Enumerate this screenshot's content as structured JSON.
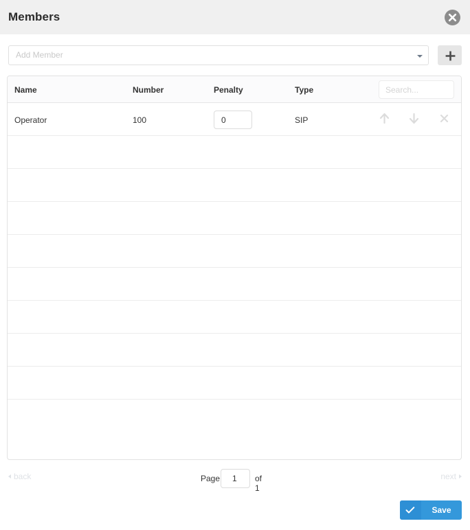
{
  "header": {
    "title": "Members",
    "close_icon": "close-circle-icon"
  },
  "add_member": {
    "placeholder": "Add Member",
    "caret_icon": "chevron-down-icon",
    "add_icon": "plus-icon"
  },
  "table": {
    "columns": [
      "Name",
      "Number",
      "Penalty",
      "Type"
    ],
    "search": {
      "placeholder": "Search..."
    },
    "row_actions": {
      "up_icon": "arrow-up-icon",
      "down_icon": "arrow-down-icon",
      "delete_icon": "close-x-icon"
    },
    "rows": [
      {
        "name": "Operator",
        "number": "100",
        "penalty": "0",
        "type": "SIP"
      }
    ],
    "empty_row_count": 9
  },
  "pager": {
    "back_label": "back",
    "next_label": "next",
    "page_label": "Page",
    "page_value": "1",
    "of_label": "of 1"
  },
  "footer": {
    "save_label": "Save",
    "save_icon": "check-icon"
  },
  "colors": {
    "titlebar_bg": "#f0f0f0",
    "accent_blue": "#3498db",
    "accent_blue_dark": "#2d8fd5",
    "border": "#e2e2e2",
    "muted_text": "#dfe2e6",
    "placeholder": "#c9c9c9"
  }
}
